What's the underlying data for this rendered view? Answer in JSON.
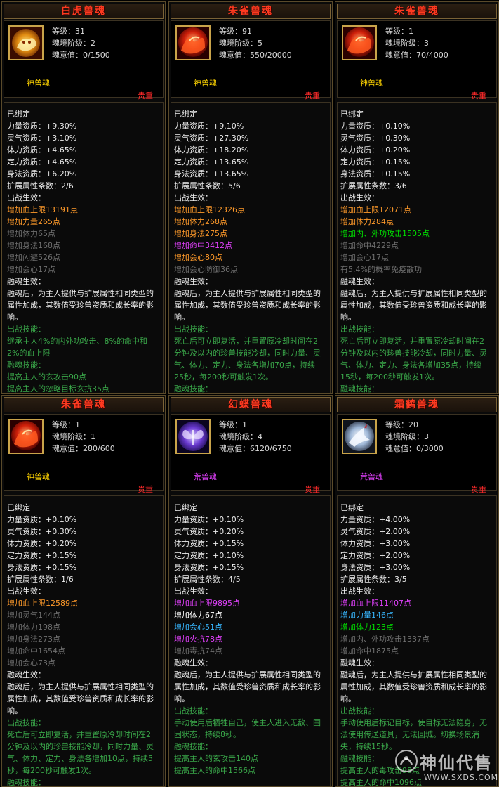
{
  "cards": [
    {
      "title": "白虎兽魂",
      "level": "等级：31",
      "stage": "魂境阶级：2",
      "soul": "魂意值：0/1500",
      "rank": "神兽魂",
      "rank_color": "#ffd400",
      "grade": "贵重",
      "icon": "white-tiger-icon",
      "lines": [
        {
          "text": "已绑定",
          "color": "c-white"
        },
        {
          "text": "力量资质：+9.30%",
          "color": "c-white"
        },
        {
          "text": "灵气资质：+3.10%",
          "color": "c-white"
        },
        {
          "text": "体力资质：+4.65%",
          "color": "c-white"
        },
        {
          "text": "定力资质：+4.65%",
          "color": "c-white"
        },
        {
          "text": "身法资质：+6.20%",
          "color": "c-white"
        },
        {
          "text": "扩展属性条数：2/6",
          "color": "c-white"
        },
        {
          "text": "出战生效：",
          "color": "c-white"
        },
        {
          "text": "增加血上限13191点",
          "color": "c-orange"
        },
        {
          "text": "增加力量265点",
          "color": "c-orange"
        },
        {
          "text": "增加体力65点",
          "color": "c-gray"
        },
        {
          "text": "增加身法168点",
          "color": "c-gray"
        },
        {
          "text": "增加闪避526点",
          "color": "c-gray"
        },
        {
          "text": "增加会心17点",
          "color": "c-gray"
        },
        {
          "text": "融魂生效：",
          "color": "c-white"
        },
        {
          "text": "融魂后，为主人提供与扩展属性相同类型的属性加成，其数值受珍兽资质和成长率的影响。",
          "color": "c-white",
          "wrap": true
        },
        {
          "text": "出战技能：",
          "color": "c-dgreen"
        },
        {
          "text": "继承主人4%的内外功攻击、8%的命中和2%的血上限",
          "color": "c-dgreen",
          "wrap": true
        },
        {
          "text": "融魂技能：",
          "color": "c-dgreen"
        },
        {
          "text": "提高主人的玄攻击90点",
          "color": "c-dgreen"
        },
        {
          "text": "提高主人的忽略目标玄抗35点",
          "color": "c-dgreen"
        }
      ]
    },
    {
      "title": "朱雀兽魂",
      "level": "等级：91",
      "stage": "魂境阶级：5",
      "soul": "魂意值：550/20000",
      "rank": "神兽魂",
      "rank_color": "#ffd400",
      "grade": "贵重",
      "icon": "vermilion-bird-icon",
      "lines": [
        {
          "text": "已绑定",
          "color": "c-white"
        },
        {
          "text": "力量资质：+9.10%",
          "color": "c-white"
        },
        {
          "text": "灵气资质：+27.30%",
          "color": "c-white"
        },
        {
          "text": "体力资质：+18.20%",
          "color": "c-white"
        },
        {
          "text": "定力资质：+13.65%",
          "color": "c-white"
        },
        {
          "text": "身法资质：+13.65%",
          "color": "c-white"
        },
        {
          "text": "扩展属性条数：5/6",
          "color": "c-white"
        },
        {
          "text": "出战生效：",
          "color": "c-white"
        },
        {
          "text": "增加血上限12326点",
          "color": "c-orange"
        },
        {
          "text": "增加体力268点",
          "color": "c-orange"
        },
        {
          "text": "增加身法275点",
          "color": "c-orange"
        },
        {
          "text": "增加命中3412点",
          "color": "c-magenta"
        },
        {
          "text": "增加会心80点",
          "color": "c-orange"
        },
        {
          "text": "增加会心防御36点",
          "color": "c-gray"
        },
        {
          "text": "融魂生效：",
          "color": "c-white"
        },
        {
          "text": "融魂后，为主人提供与扩展属性相同类型的属性加成，其数值受珍兽资质和成长率的影响。",
          "color": "c-white",
          "wrap": true
        },
        {
          "text": "出战技能：",
          "color": "c-dgreen"
        },
        {
          "text": "死亡后可立即复活，并重置原冷却时间在2分钟及以内的珍兽技能冷却，同时力量、灵气、体力、定力、身法各增加70点，持续25秒，每200秒可触发1次。",
          "color": "c-dgreen",
          "wrap": true
        },
        {
          "text": "融魂技能：",
          "color": "c-dgreen"
        }
      ]
    },
    {
      "title": "朱雀兽魂",
      "level": "等级：1",
      "stage": "魂境阶级：3",
      "soul": "魂意值：70/4000",
      "rank": "神兽魂",
      "rank_color": "#ffd400",
      "grade": "贵重",
      "icon": "vermilion-bird-icon",
      "lines": [
        {
          "text": "已绑定",
          "color": "c-white"
        },
        {
          "text": "力量资质：+0.10%",
          "color": "c-white"
        },
        {
          "text": "灵气资质：+0.30%",
          "color": "c-white"
        },
        {
          "text": "体力资质：+0.20%",
          "color": "c-white"
        },
        {
          "text": "定力资质：+0.15%",
          "color": "c-white"
        },
        {
          "text": "身法资质：+0.15%",
          "color": "c-white"
        },
        {
          "text": "扩展属性条数：3/6",
          "color": "c-white"
        },
        {
          "text": "出战生效：",
          "color": "c-white"
        },
        {
          "text": "增加血上限12071点",
          "color": "c-orange"
        },
        {
          "text": "增加体力284点",
          "color": "c-orange"
        },
        {
          "text": "增加内、外功攻击1505点",
          "color": "c-green"
        },
        {
          "text": "增加命中4229点",
          "color": "c-gray"
        },
        {
          "text": "增加会心17点",
          "color": "c-gray"
        },
        {
          "text": "有5.4%的概率免疫散功",
          "color": "c-gray"
        },
        {
          "text": "融魂生效：",
          "color": "c-white"
        },
        {
          "text": "融魂后，为主人提供与扩展属性相同类型的属性加成，其数值受珍兽资质和成长率的影响。",
          "color": "c-white",
          "wrap": true
        },
        {
          "text": "出战技能：",
          "color": "c-dgreen"
        },
        {
          "text": "死亡后可立即复活，并重置原冷却时间在2分钟及以内的珍兽技能冷却，同时力量、灵气、体力、定力、身法各增加35点，持续15秒，每200秒可触发1次。",
          "color": "c-dgreen",
          "wrap": true
        },
        {
          "text": "融魂技能：",
          "color": "c-dgreen"
        }
      ]
    },
    {
      "title": "朱雀兽魂",
      "level": "等级：1",
      "stage": "魂境阶级：1",
      "soul": "魂意值：280/600",
      "rank": "神兽魂",
      "rank_color": "#ffd400",
      "grade": "贵重",
      "icon": "vermilion-bird-icon",
      "lines": [
        {
          "text": "已绑定",
          "color": "c-white"
        },
        {
          "text": "力量资质：+0.10%",
          "color": "c-white"
        },
        {
          "text": "灵气资质：+0.30%",
          "color": "c-white"
        },
        {
          "text": "体力资质：+0.20%",
          "color": "c-white"
        },
        {
          "text": "定力资质：+0.15%",
          "color": "c-white"
        },
        {
          "text": "身法资质：+0.15%",
          "color": "c-white"
        },
        {
          "text": "扩展属性条数：1/6",
          "color": "c-white"
        },
        {
          "text": "出战生效：",
          "color": "c-white"
        },
        {
          "text": "增加血上限12589点",
          "color": "c-orange"
        },
        {
          "text": "增加灵气144点",
          "color": "c-gray"
        },
        {
          "text": "增加体力198点",
          "color": "c-gray"
        },
        {
          "text": "增加身法273点",
          "color": "c-gray"
        },
        {
          "text": "增加命中1654点",
          "color": "c-gray"
        },
        {
          "text": "增加会心73点",
          "color": "c-gray"
        },
        {
          "text": "融魂生效：",
          "color": "c-white"
        },
        {
          "text": "融魂后，为主人提供与扩展属性相同类型的属性加成，其数值受珍兽资质和成长率的影响。",
          "color": "c-white",
          "wrap": true
        },
        {
          "text": "出战技能：",
          "color": "c-dgreen"
        },
        {
          "text": "死亡后可立即复活，并重置原冷却时间在2分钟及以内的珍兽技能冷却，同时力量、灵气、体力、定力、身法各增加10点，持续5秒，每200秒可触发1次。",
          "color": "c-dgreen",
          "wrap": true
        },
        {
          "text": "融魂技能：",
          "color": "c-dgreen"
        }
      ]
    },
    {
      "title": "幻蝶兽魂",
      "level": "等级：1",
      "stage": "魂境阶级：4",
      "soul": "魂意值：6120/6750",
      "rank": "荒兽魂",
      "rank_color": "#e040fb",
      "grade": "贵重",
      "icon": "butterfly-icon",
      "lines": [
        {
          "text": "已绑定",
          "color": "c-white"
        },
        {
          "text": "力量资质：+0.10%",
          "color": "c-white"
        },
        {
          "text": "灵气资质：+0.20%",
          "color": "c-white"
        },
        {
          "text": "体力资质：+0.15%",
          "color": "c-white"
        },
        {
          "text": "定力资质：+0.10%",
          "color": "c-white"
        },
        {
          "text": "身法资质：+0.15%",
          "color": "c-white"
        },
        {
          "text": "扩展属性条数：4/5",
          "color": "c-white"
        },
        {
          "text": "出战生效：",
          "color": "c-white"
        },
        {
          "text": "增加血上限9895点",
          "color": "c-magenta"
        },
        {
          "text": "增加体力67点",
          "color": "c-whiteb"
        },
        {
          "text": "增加会心51点",
          "color": "c-blue"
        },
        {
          "text": "增加火抗78点",
          "color": "c-magenta"
        },
        {
          "text": "增加毒抗74点",
          "color": "c-gray"
        },
        {
          "text": "融魂生效：",
          "color": "c-white"
        },
        {
          "text": "融魂后，为主人提供与扩展属性相同类型的属性加成，其数值受珍兽资质和成长率的影响。",
          "color": "c-white",
          "wrap": true
        },
        {
          "text": "出战技能：",
          "color": "c-dgreen"
        },
        {
          "text": "手动使用后牺牲自己，使主人进入无敌、围困状态，持续8秒。",
          "color": "c-dgreen",
          "wrap": true
        },
        {
          "text": "融魂技能：",
          "color": "c-dgreen"
        },
        {
          "text": "提高主人的玄攻击140点",
          "color": "c-dgreen"
        },
        {
          "text": "提高主人的命中1566点",
          "color": "c-dgreen"
        }
      ]
    },
    {
      "title": "霜鹤兽魂",
      "level": "等级：20",
      "stage": "魂境阶级：3",
      "soul": "魂意值：0/3000",
      "rank": "荒兽魂",
      "rank_color": "#e040fb",
      "grade": "贵重",
      "icon": "frost-crane-icon",
      "lines": [
        {
          "text": "已绑定",
          "color": "c-white"
        },
        {
          "text": "力量资质：+4.00%",
          "color": "c-white"
        },
        {
          "text": "灵气资质：+2.00%",
          "color": "c-white"
        },
        {
          "text": "体力资质：+3.00%",
          "color": "c-white"
        },
        {
          "text": "定力资质：+2.00%",
          "color": "c-white"
        },
        {
          "text": "身法资质：+3.00%",
          "color": "c-white"
        },
        {
          "text": "扩展属性条数：3/5",
          "color": "c-white"
        },
        {
          "text": "出战生效：",
          "color": "c-white"
        },
        {
          "text": "增加血上限11407点",
          "color": "c-magenta"
        },
        {
          "text": "增加力量146点",
          "color": "c-blue"
        },
        {
          "text": "增加体力123点",
          "color": "c-green"
        },
        {
          "text": "增加内、外功攻击1337点",
          "color": "c-gray"
        },
        {
          "text": "增加命中1875点",
          "color": "c-gray"
        },
        {
          "text": "融魂生效：",
          "color": "c-white"
        },
        {
          "text": "融魂后，为主人提供与扩展属性相同类型的属性加成，其数值受珍兽资质和成长率的影响。",
          "color": "c-white",
          "wrap": true
        },
        {
          "text": "出战技能：",
          "color": "c-dgreen"
        },
        {
          "text": "手动使用后标记目标，使目标无法隐身，无法使用传送道具，无法回城。切换场景消失，持续15秒。",
          "color": "c-dgreen",
          "wrap": true
        },
        {
          "text": "融魂技能：",
          "color": "c-dgreen"
        },
        {
          "text": "提高主人的毒攻击98点",
          "color": "c-dgreen"
        },
        {
          "text": "提高主人的命中1096点",
          "color": "c-dgreen"
        }
      ]
    }
  ],
  "watermark": {
    "text": "神仙代售",
    "url": "WWW.SXDS.COM"
  }
}
